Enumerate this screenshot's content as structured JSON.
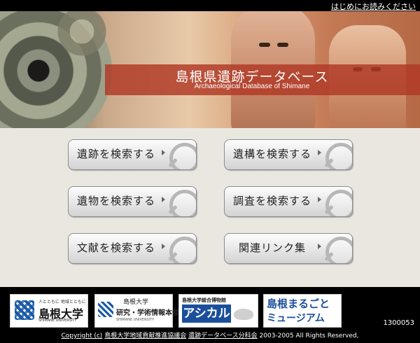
{
  "top_link": "はじめにお読みください",
  "header": {
    "title_ja": "島根県遺跡データベース",
    "title_en": "Archaeological Database of Shimane"
  },
  "buttons": [
    {
      "id": "site",
      "label": "遺跡を検索する"
    },
    {
      "id": "feature",
      "label": "遺構を検索する"
    },
    {
      "id": "artifact",
      "label": "遺物を検索する"
    },
    {
      "id": "survey",
      "label": "調査を検索する"
    },
    {
      "id": "literature",
      "label": "文献を検索する"
    },
    {
      "id": "links",
      "label": "関連リンク集"
    }
  ],
  "footer": {
    "logos": {
      "shimane_university": {
        "small": "人とともに 地域とともに",
        "name": "島根大学",
        "en": "SHIMANE UNIVERSITY"
      },
      "library": {
        "line1": "島根大学",
        "line2": "研究・学術情報本部",
        "line3": "SHIMANE UNIVERSITY"
      },
      "ashikaru": {
        "line1": "島根大学総合博物館",
        "line2": "アシカル"
      },
      "museum": {
        "line1": "島根まるごと",
        "line2": "ミュージアム"
      }
    },
    "counter": "1300053",
    "copyright_prefix": "Copyright (c)",
    "copyright_org1": "島根大学地域貢献推進協議会",
    "copyright_org2": "遺跡データベース分科会",
    "copyright_suffix": "2003-2005 All Rights Reserved,"
  },
  "colors": {
    "title_band": "#b03824",
    "background": "#e9e7e0",
    "footer": "#000000"
  }
}
